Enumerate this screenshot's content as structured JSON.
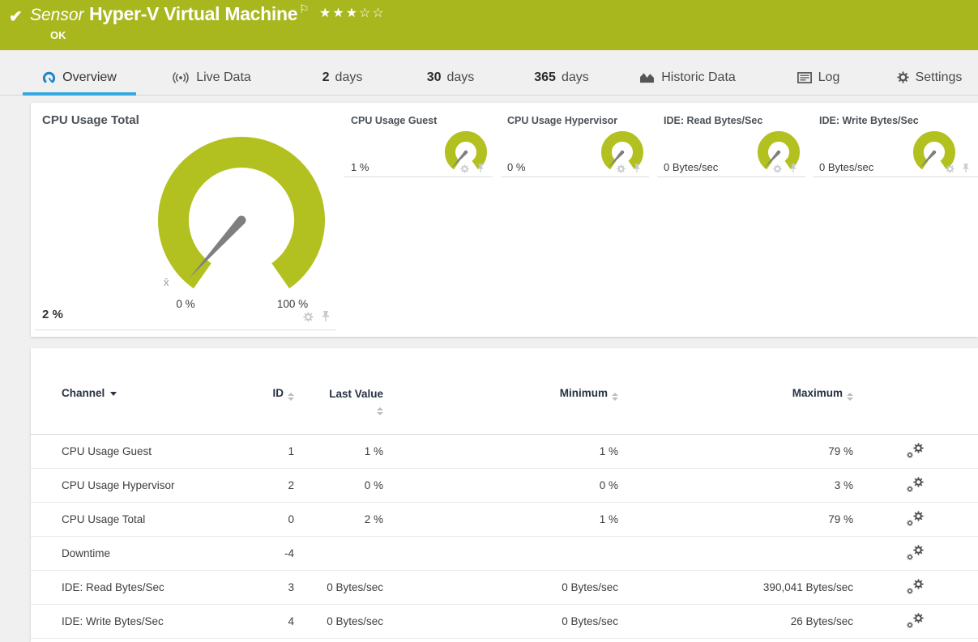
{
  "header": {
    "status_glyph": "✔",
    "type_label": "Sensor",
    "title": "Hyper-V Virtual Machine",
    "flag_glyph": "⚐",
    "stars_filled": "★★★",
    "stars_empty": "☆☆",
    "status": "OK"
  },
  "tabs": [
    {
      "label": "Overview"
    },
    {
      "label": "Live Data"
    },
    {
      "num": "2",
      "label": "days"
    },
    {
      "num": "30",
      "label": "days"
    },
    {
      "num": "365",
      "label": "days"
    },
    {
      "label": "Historic Data"
    },
    {
      "label": "Log"
    },
    {
      "label": "Settings"
    }
  ],
  "gauges": {
    "primary": {
      "title": "CPU Usage Total",
      "value": "2 %",
      "scale_min": "0 %",
      "scale_max": "100 %",
      "value_percent": 2
    },
    "mini": [
      {
        "title": "CPU Usage Guest",
        "value": "1 %",
        "value_percent": 1
      },
      {
        "title": "CPU Usage Hypervisor",
        "value": "0 %",
        "value_percent": 0
      },
      {
        "title": "IDE: Read Bytes/Sec",
        "value": "0 Bytes/sec",
        "value_percent": 0
      },
      {
        "title": "IDE: Write Bytes/Sec",
        "value": "0 Bytes/sec",
        "value_percent": 0
      }
    ],
    "mean_marker_glyph": "x̄"
  },
  "channel_table": {
    "columns": {
      "channel": "Channel",
      "id": "ID",
      "last": "Last Value",
      "min": "Minimum",
      "max": "Maximum"
    },
    "rows": [
      {
        "channel": "CPU Usage Guest",
        "id": "1",
        "last": "1 %",
        "min": "1 %",
        "max": "79 %"
      },
      {
        "channel": "CPU Usage Hypervisor",
        "id": "2",
        "last": "0 %",
        "min": "0 %",
        "max": "3 %"
      },
      {
        "channel": "CPU Usage Total",
        "id": "0",
        "last": "2 %",
        "min": "1 %",
        "max": "79 %"
      },
      {
        "channel": "Downtime",
        "id": "-4",
        "last": "",
        "min": "",
        "max": ""
      },
      {
        "channel": "IDE: Read Bytes/Sec",
        "id": "3",
        "last": "0 Bytes/sec",
        "min": "0 Bytes/sec",
        "max": "390,041 Bytes/sec"
      },
      {
        "channel": "IDE: Write Bytes/Sec",
        "id": "4",
        "last": "0 Bytes/sec",
        "min": "0 Bytes/sec",
        "max": "26 Bytes/sec"
      }
    ]
  },
  "colors": {
    "header_bg": "#a9b71f",
    "gauge_green": "#b2c120",
    "accent_blue": "#35a8e0",
    "needle_gray": "#7f7f7f"
  }
}
